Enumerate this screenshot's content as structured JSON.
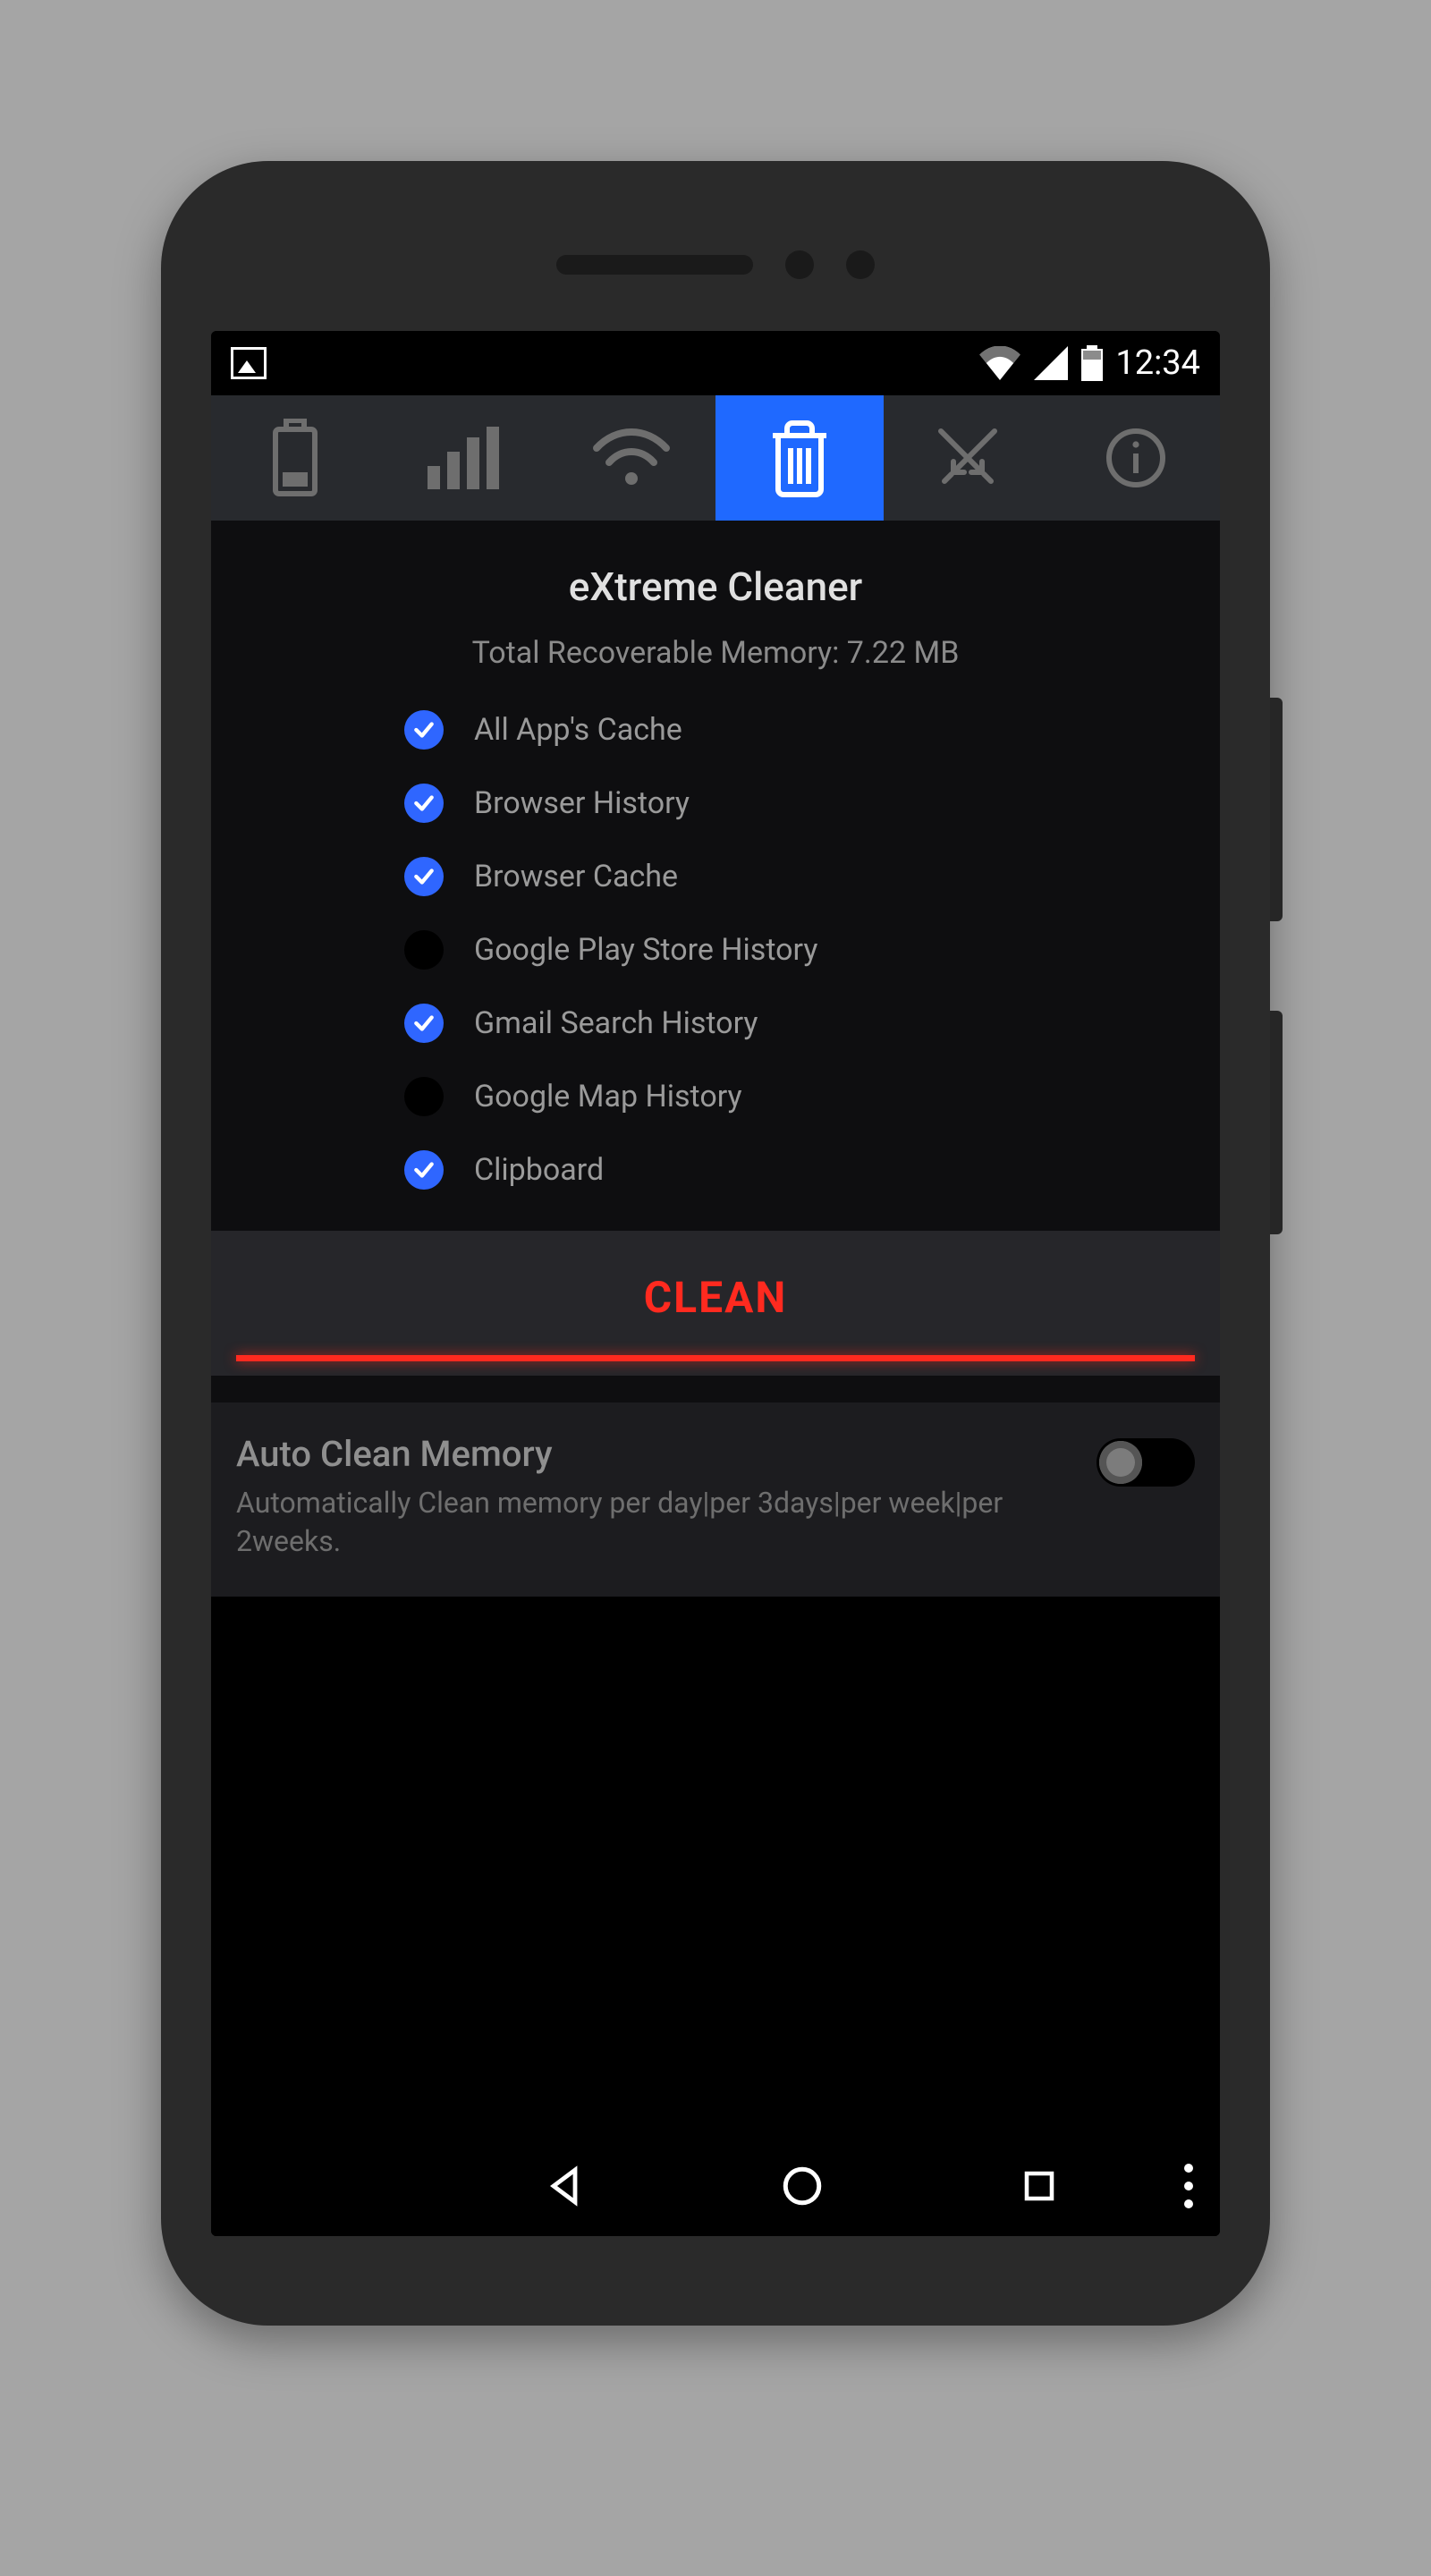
{
  "status": {
    "time": "12:34"
  },
  "header": {
    "title": "eXtreme Cleaner",
    "subtitle": "Total Recoverable Memory: 7.22 MB"
  },
  "options": [
    {
      "label": "All App's Cache",
      "checked": true
    },
    {
      "label": "Browser History",
      "checked": true
    },
    {
      "label": "Browser Cache",
      "checked": true
    },
    {
      "label": "Google Play Store History",
      "checked": false
    },
    {
      "label": "Gmail Search History",
      "checked": true
    },
    {
      "label": "Google Map History",
      "checked": false
    },
    {
      "label": "Clipboard",
      "checked": true
    }
  ],
  "clean_button": "CLEAN",
  "auto_clean": {
    "title": "Auto Clean Memory",
    "description": "Automatically Clean memory per day|per 3days|per week|per 2weeks.",
    "enabled": false
  }
}
